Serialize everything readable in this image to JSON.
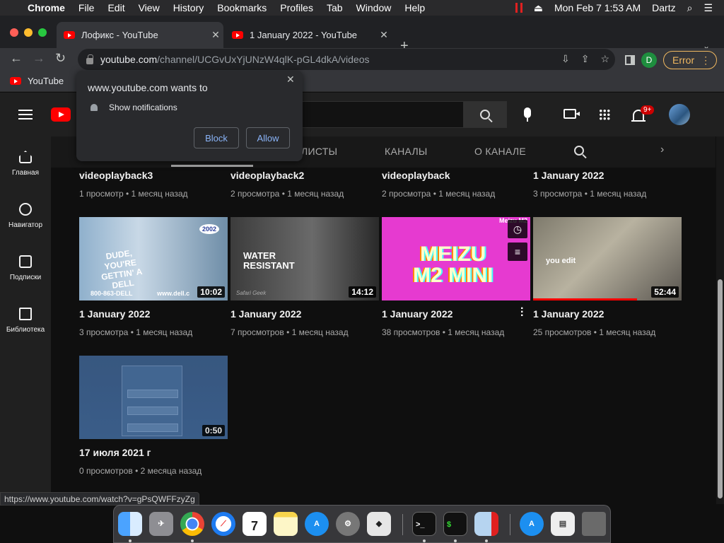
{
  "menubar": {
    "app_name": "Chrome",
    "items": [
      "File",
      "Edit",
      "View",
      "History",
      "Bookmarks",
      "Profiles",
      "Tab",
      "Window",
      "Help"
    ],
    "datetime": "Mon Feb 7  1:53 AM",
    "user": "Dartz"
  },
  "tabs": [
    {
      "title": "Лофикс - YouTube",
      "active": true
    },
    {
      "title": "1 January 2022 - YouTube",
      "active": false
    }
  ],
  "toolbar": {
    "url_host": "youtube.com",
    "url_path": "/channel/UCGvUxYjUNzW4qlK-pGL4dkA/videos",
    "profile_initial": "D",
    "error_label": "Error"
  },
  "bookmarks": [
    {
      "label": "YouTube"
    }
  ],
  "notification_prompt": {
    "title": "www.youtube.com wants to",
    "permission": "Show notifications",
    "block_label": "Block",
    "allow_label": "Allow"
  },
  "youtube_header": {
    "notifications_badge": "9+"
  },
  "sidebar": [
    {
      "label": "Главная",
      "icon": "home-icon"
    },
    {
      "label": "Навигатор",
      "icon": "compass-icon"
    },
    {
      "label": "Подписки",
      "icon": "subscriptions-icon"
    },
    {
      "label": "Библиотека",
      "icon": "library-icon"
    }
  ],
  "channel_tabs": [
    "ЛИСТЫ",
    "КАНАЛЫ",
    "О КАНАЛЕ"
  ],
  "videos_top_row": [
    {
      "title": "videoplayback3",
      "meta": "1 просмотр • 1 месяц назад"
    },
    {
      "title": "videoplayback2",
      "meta": "2 просмотра • 1 месяц назад"
    },
    {
      "title": "videoplayback",
      "meta": "2 просмотра • 1 месяц назад"
    },
    {
      "title": "1 January 2022",
      "meta": "3 просмотра • 1 месяц назад"
    }
  ],
  "videos": [
    {
      "title": "1 January 2022",
      "meta": "3 просмотра • 1 месяц назад",
      "duration": "10:02",
      "thumb_text": [
        "DUDE,",
        "YOU'RE",
        "GETTIN' A",
        "DELL"
      ],
      "thumb_phone": "800-863-DELL",
      "thumb_site": "www.dell.c",
      "thumb_logo": "2002"
    },
    {
      "title": "1 January 2022",
      "meta": "7 просмотров • 1 месяц назад",
      "duration": "14:12",
      "thumb_text": [
        "WATER",
        "RESISTANT"
      ],
      "thumb_sig": "Safari Geek"
    },
    {
      "title": "1 January 2022",
      "meta": "38 просмотров • 1 месяц назад",
      "duration": "",
      "thumb_text": [
        "MEIZU",
        "M2 MINI"
      ],
      "thumb_corner": "Meizu M2"
    },
    {
      "title": "1 January 2022",
      "meta": "25 просмотров • 1 месяц назад",
      "duration": "52:44",
      "thumb_text": [
        "you edit"
      ],
      "watched_fraction": 0.7
    },
    {
      "title": "17 июля 2021 г",
      "meta": "0 просмотров • 2 месяца назад",
      "duration": "0:50"
    }
  ],
  "status_url": "https://www.youtube.com/watch?v=gPsQWFFzyZg",
  "dock": [
    {
      "name": "Finder",
      "icon": "finder-icon"
    },
    {
      "name": "Launchpad",
      "icon": "launchpad-icon"
    },
    {
      "name": "Chrome",
      "icon": "chrome-icon"
    },
    {
      "name": "Safari",
      "icon": "safari-icon"
    },
    {
      "name": "Calendar",
      "icon": "calendar-icon",
      "day": "7",
      "month": "FEB"
    },
    {
      "name": "Notes",
      "icon": "notes-icon"
    },
    {
      "name": "App Store",
      "icon": "app-store-icon"
    },
    {
      "name": "System Preferences",
      "icon": "system-preferences-icon"
    },
    {
      "name": "Roblox",
      "icon": "roblox-icon"
    },
    {
      "name": "Terminal",
      "icon": "terminal-icon"
    },
    {
      "name": "Terminal",
      "icon": "terminal-icon"
    },
    {
      "name": "Screen",
      "icon": "screen-icon"
    },
    {
      "name": "App Store",
      "icon": "app-store-icon"
    },
    {
      "name": "Document",
      "icon": "document-icon"
    },
    {
      "name": "Trash",
      "icon": "trash-icon"
    }
  ]
}
